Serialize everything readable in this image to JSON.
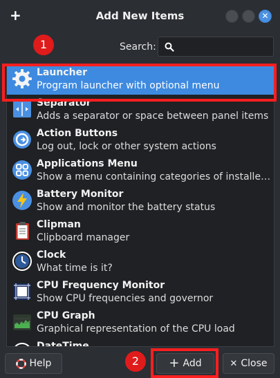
{
  "window": {
    "title": "Add New Items"
  },
  "search": {
    "label": "Search:",
    "value": ""
  },
  "items": [
    {
      "name": "Launcher",
      "desc": "Program launcher with optional menu",
      "icon": "gear-icon",
      "selected": true
    },
    {
      "name": "Separator",
      "desc": "Adds a separator or space between panel items",
      "icon": "separator-icon"
    },
    {
      "name": "Action Buttons",
      "desc": "Log out, lock or other system actions",
      "icon": "power-icon"
    },
    {
      "name": "Applications Menu",
      "desc": "Show a menu containing categories of installed ap...",
      "icon": "apps-grid-icon"
    },
    {
      "name": "Battery Monitor",
      "desc": "Show and monitor the battery status",
      "icon": "battery-icon"
    },
    {
      "name": "Clipman",
      "desc": "Clipboard manager",
      "icon": "clipboard-icon"
    },
    {
      "name": "Clock",
      "desc": "What time is it?",
      "icon": "clock-icon"
    },
    {
      "name": "CPU Frequency Monitor",
      "desc": "Show CPU frequencies and governor",
      "icon": "cpu-icon"
    },
    {
      "name": "CPU Graph",
      "desc": "Graphical representation of the CPU load",
      "icon": "graph-icon"
    },
    {
      "name": "DateTime",
      "desc": "",
      "icon": "calendar-icon"
    }
  ],
  "buttons": {
    "help": "Help",
    "add": "Add",
    "close": "Close"
  },
  "annotations": {
    "badge1": "1",
    "badge2": "2"
  },
  "colors": {
    "selected": "#3e8ae0",
    "highlight": "#ff1f1f",
    "badge": "#e01b1b"
  }
}
